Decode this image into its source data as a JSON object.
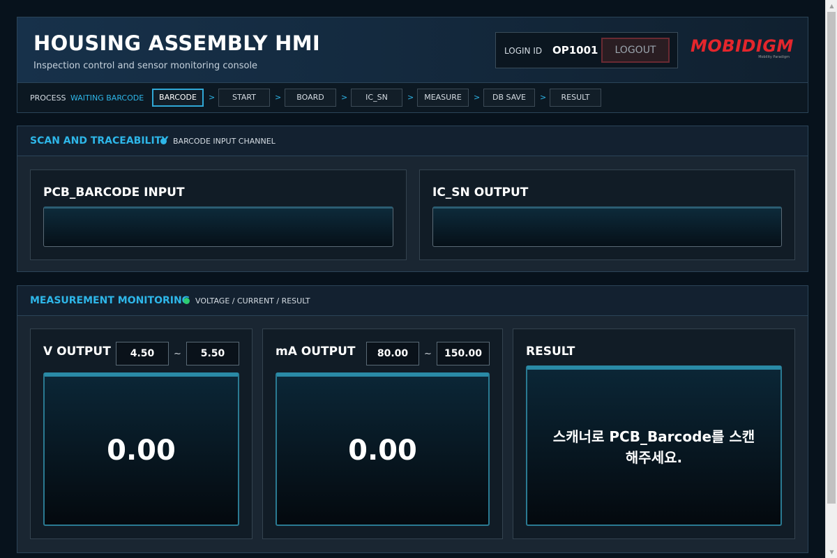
{
  "header": {
    "title": "HOUSING ASSEMBLY HMI",
    "subtitle": "Inspection control and sensor monitoring console",
    "login_label": "LOGIN ID",
    "login_id": "OP1001",
    "logout_label": "LOGOUT",
    "logo_text": "MOBIDIGM",
    "logo_tagline": "Mobility Paradigm"
  },
  "process": {
    "label": "PROCESS",
    "state": "WAITING BARCODE",
    "separator": ">",
    "steps": [
      {
        "label": "BARCODE",
        "active": true
      },
      {
        "label": "START",
        "active": false
      },
      {
        "label": "BOARD",
        "active": false
      },
      {
        "label": "IC_SN",
        "active": false
      },
      {
        "label": "MEASURE",
        "active": false
      },
      {
        "label": "DB SAVE",
        "active": false
      },
      {
        "label": "RESULT",
        "active": false
      }
    ]
  },
  "scan_panel": {
    "title": "SCAN AND TRACEABILITY",
    "subtitle": "BARCODE INPUT CHANNEL",
    "dot_color": "#2eb6e8",
    "pcb_title": "PCB_BARCODE INPUT",
    "pcb_value": "",
    "icsn_title": "IC_SN OUTPUT",
    "icsn_value": ""
  },
  "measure_panel": {
    "title": "MEASUREMENT MONITORING",
    "subtitle": "VOLTAGE / CURRENT / RESULT",
    "dot_color": "#2ecc71",
    "tilde": "~",
    "v_title": "V OUTPUT",
    "v_min": "4.50",
    "v_max": "5.50",
    "v_value": "0.00",
    "ma_title": "mA OUTPUT",
    "ma_min": "80.00",
    "ma_max": "150.00",
    "ma_value": "0.00",
    "result_title": "RESULT",
    "result_message": "스캐너로 PCB_Barcode를 스캔해주세요."
  },
  "colors": {
    "accent": "#2eb6e8",
    "logo_red": "#e4262c",
    "logout_border": "#6a2a32"
  }
}
